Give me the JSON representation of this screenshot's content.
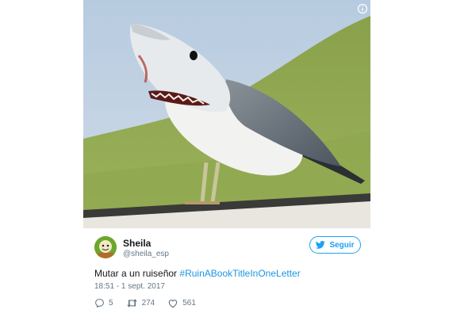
{
  "tweet": {
    "user": {
      "name": "Sheila",
      "handle": "@sheila_esp"
    },
    "follow_label": "Seguir",
    "text": "Mutar a un ruiseñor",
    "hashtag": "#RuinABookTitleInOneLetter",
    "timestamp": "18:51 - 1 sept. 2017",
    "replies": "5",
    "retweets": "274",
    "likes": "561"
  },
  "icons": {
    "info": "info-icon",
    "follow": "twitter-bird-icon",
    "reply": "reply-icon",
    "retweet": "retweet-icon",
    "like": "heart-icon"
  },
  "colors": {
    "accent": "#1da1f2",
    "hashtag": "#1b95e0",
    "muted": "#657786"
  }
}
